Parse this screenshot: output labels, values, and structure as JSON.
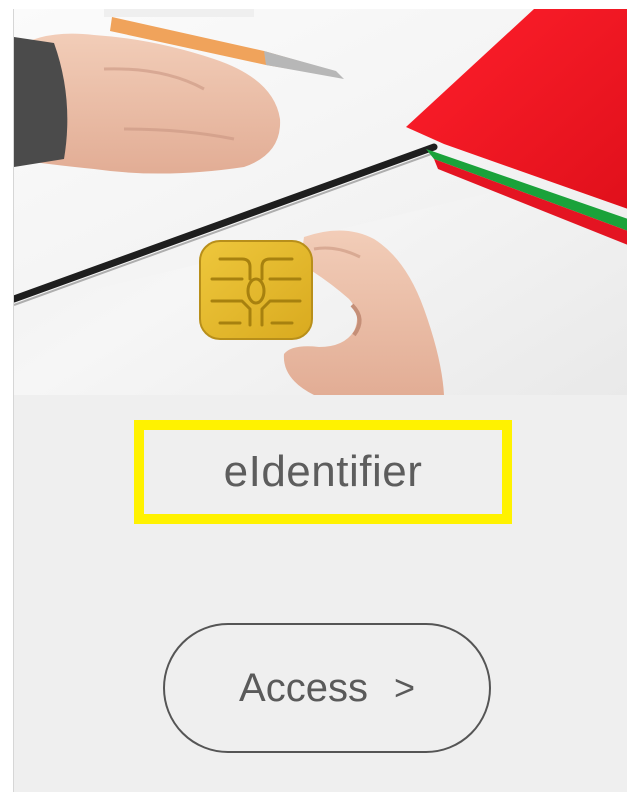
{
  "card": {
    "title": "eIdentifier",
    "access_button": {
      "label": "Access",
      "chevron": ">"
    },
    "hero_image": {
      "icon": "smart-card-chip-icon"
    }
  },
  "colors": {
    "highlight": "#fff200",
    "card_background": "#efefef",
    "text": "#5d5d5d",
    "chip": "#e6be2a",
    "folder_red": "#f0101e",
    "folder_green": "#1aa23a"
  }
}
